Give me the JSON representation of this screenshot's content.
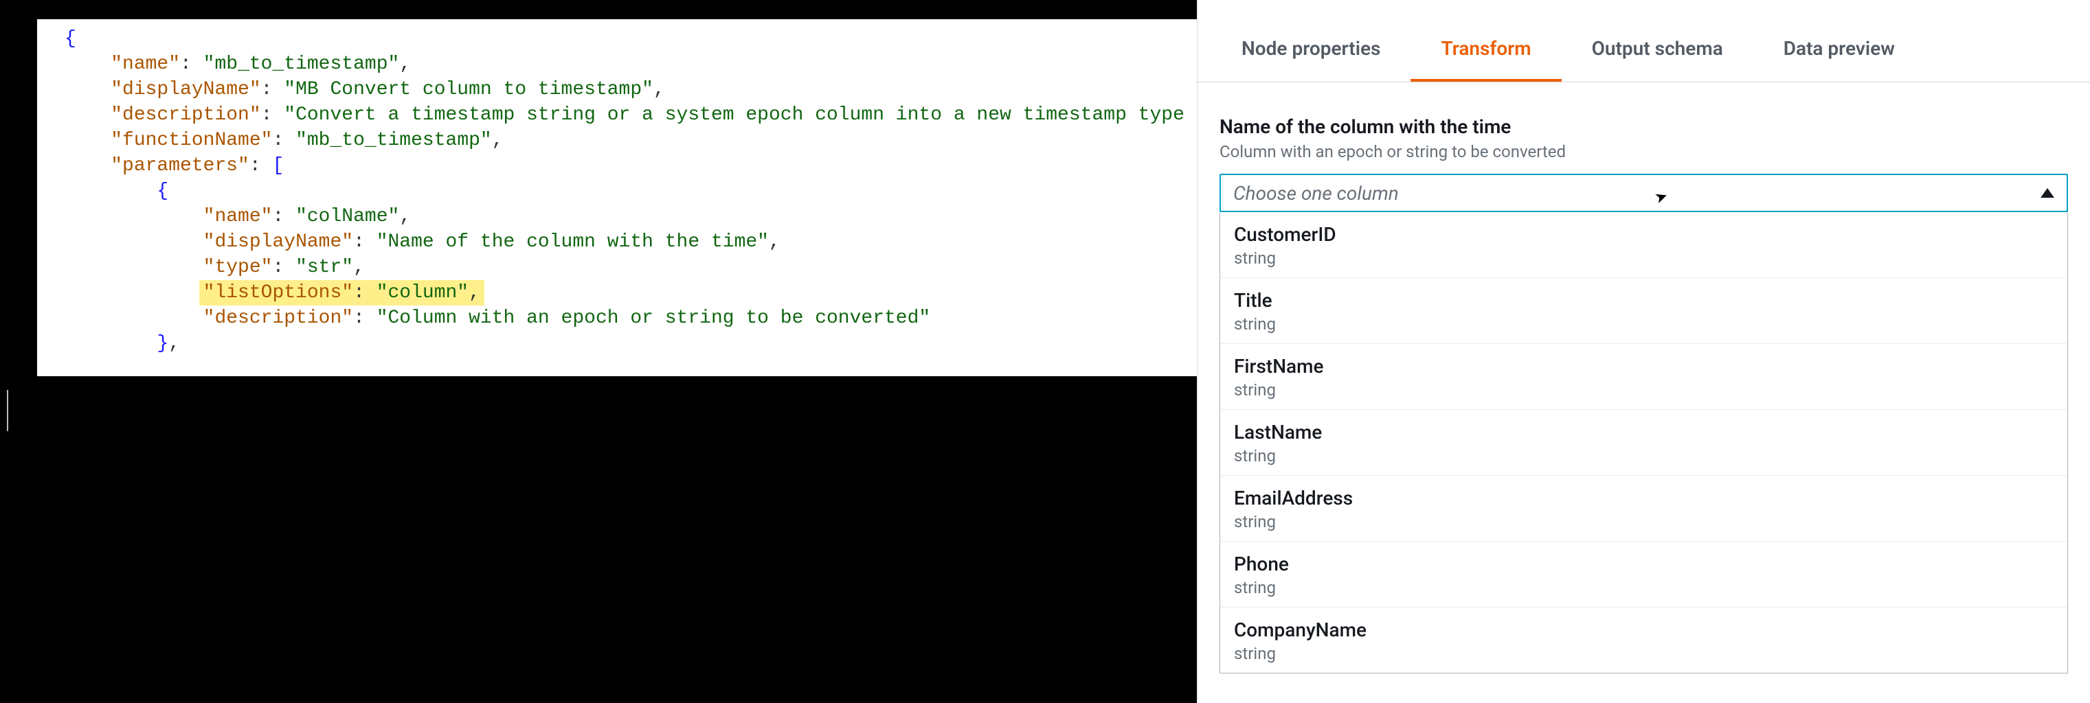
{
  "code": {
    "raw": "{\n    \"name\": \"mb_to_timestamp\",\n    \"displayName\": \"MB Convert column to timestamp\",\n    \"description\": \"Convert a timestamp string or a system epoch column into a new timestamp type column.\",\n    \"functionName\": \"mb_to_timestamp\",\n    \"parameters\": [\n        {\n            \"name\": \"colName\",\n            \"displayName\": \"Name of the column with the time\",\n            \"type\": \"str\",\n            \"listOptions\": \"column\",\n            \"description\": \"Column with an epoch or string to be converted\"\n        },",
    "highlight_line": "\"listOptions\": \"column\","
  },
  "panel": {
    "tabs": [
      {
        "id": "node",
        "label": "Node properties"
      },
      {
        "id": "transform",
        "label": "Transform"
      },
      {
        "id": "schema",
        "label": "Output schema"
      },
      {
        "id": "preview",
        "label": "Data preview"
      }
    ],
    "active_tab": "transform",
    "field": {
      "label": "Name of the column with the time",
      "hint": "Column with an epoch or string to be converted",
      "placeholder": "Choose one column"
    },
    "dropdown": [
      {
        "name": "CustomerID",
        "type": "string"
      },
      {
        "name": "Title",
        "type": "string"
      },
      {
        "name": "FirstName",
        "type": "string"
      },
      {
        "name": "LastName",
        "type": "string"
      },
      {
        "name": "EmailAddress",
        "type": "string"
      },
      {
        "name": "Phone",
        "type": "string"
      },
      {
        "name": "CompanyName",
        "type": "string"
      }
    ]
  }
}
